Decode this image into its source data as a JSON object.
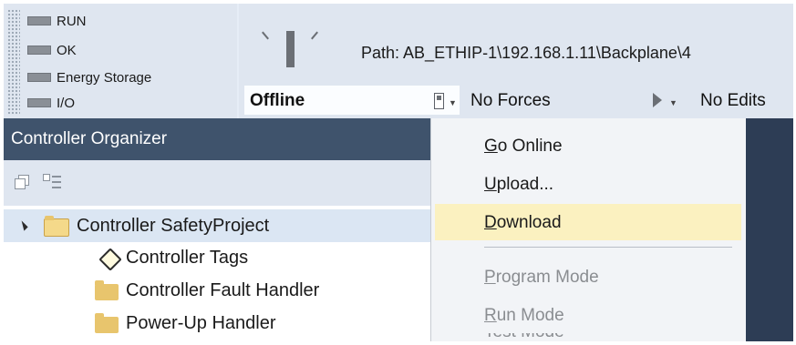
{
  "status": {
    "items": [
      "RUN",
      "OK",
      "Energy Storage",
      "I/O"
    ]
  },
  "path": {
    "label": "Path:",
    "value": "AB_ETHIP-1\\192.168.1.11\\Backplane\\4"
  },
  "toolbar": {
    "mode": "Offline",
    "forces": "No Forces",
    "edits": "No Edits"
  },
  "organizer": {
    "title": "Controller Organizer",
    "tree": [
      "Controller SafetyProject",
      "Controller Tags",
      "Controller Fault Handler",
      "Power-Up Handler"
    ]
  },
  "menu": {
    "items": [
      {
        "label": "Go Online",
        "accel": "G",
        "rest": "o Online"
      },
      {
        "label": "Upload...",
        "accel": "U",
        "rest": "pload..."
      },
      {
        "label": "Download",
        "accel": "D",
        "rest": "ownload"
      },
      {
        "label": "Program Mode",
        "accel": "P",
        "rest": "rogram Mode"
      },
      {
        "label": "Run Mode",
        "accel": "R",
        "rest": "un Mode"
      },
      {
        "label": "Test Mode",
        "accel": "T",
        "rest": "est Mode"
      }
    ]
  },
  "colors": {
    "organizer_header": "#3f536c",
    "menu_highlight": "#fbf1c0",
    "status_led": "#8a8f96"
  }
}
